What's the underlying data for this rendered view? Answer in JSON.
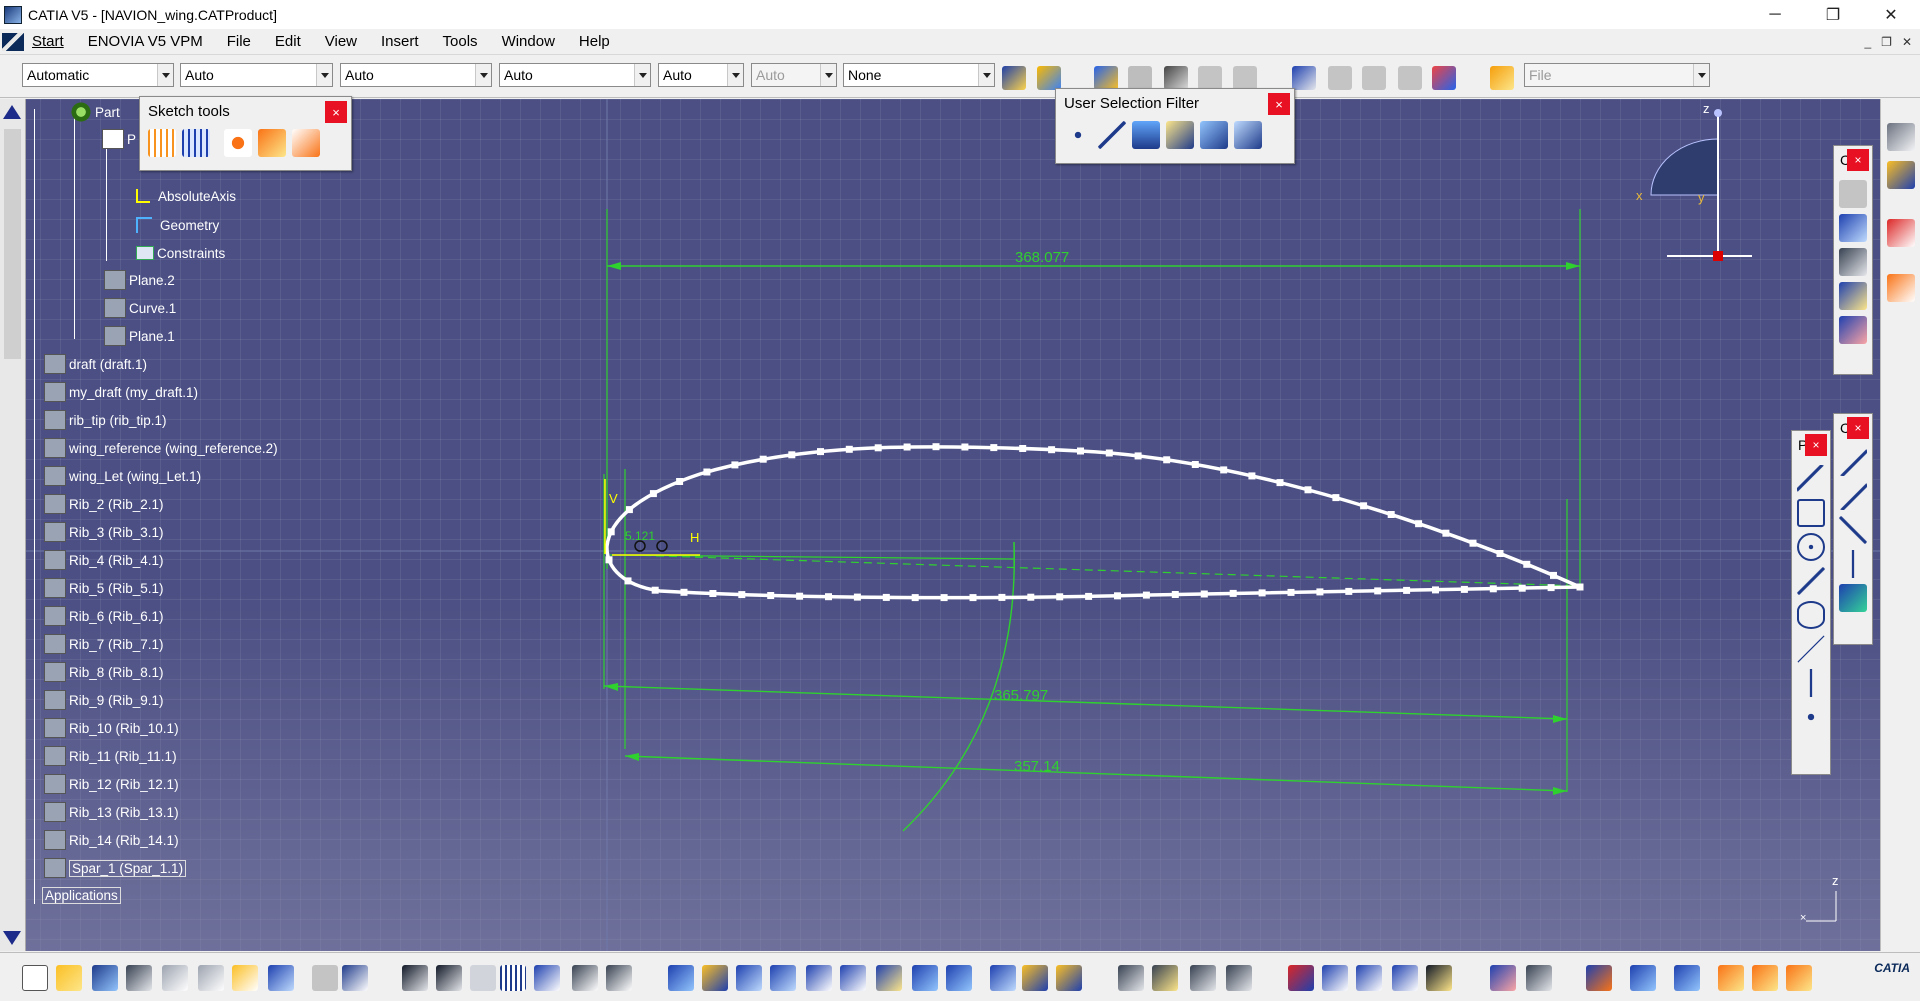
{
  "window": {
    "title": "CATIA V5 - [NAVION_wing.CATProduct]",
    "controls": {
      "minimize": "─",
      "restore": "❐",
      "close": "✕"
    }
  },
  "menu": {
    "items": [
      "Start",
      "ENOVIA V5 VPM",
      "File",
      "Edit",
      "View",
      "Insert",
      "Tools",
      "Window",
      "Help"
    ],
    "mdi_controls": {
      "minimize": "_",
      "restore": "❐",
      "close": "✕"
    }
  },
  "toolbar": {
    "combos": [
      {
        "value": "Automatic",
        "disabled": false
      },
      {
        "value": "Auto",
        "disabled": false
      },
      {
        "value": "Auto",
        "disabled": false
      },
      {
        "value": "Auto",
        "disabled": false
      },
      {
        "value": "Auto",
        "disabled": false
      },
      {
        "value": "Auto",
        "disabled": true
      },
      {
        "value": "None",
        "disabled": false
      },
      {
        "value": "File",
        "disabled": true
      }
    ]
  },
  "sketch_tools": {
    "title": "Sketch tools",
    "close": "×"
  },
  "user_selection_filter": {
    "title": "User Selection Filter",
    "close": "×"
  },
  "side_panels": {
    "panel_c1": {
      "label": "C",
      "close": "×"
    },
    "panel_c2": {
      "label": "C",
      "close": "×"
    },
    "panel_p": {
      "label": "P",
      "close": "×"
    }
  },
  "tree": {
    "nodes": [
      {
        "label": "Part",
        "icon": "gear-icon"
      },
      {
        "label": "P",
        "icon": "part-icon"
      },
      {
        "label": "AbsoluteAxis",
        "icon": "axis-icon"
      },
      {
        "label": "Geometry",
        "icon": "geometry-icon"
      },
      {
        "label": "Constraints",
        "icon": "constraints-icon"
      },
      {
        "label": "Plane.2",
        "icon": "plane-icon"
      },
      {
        "label": "Curve.1",
        "icon": "curve-icon"
      },
      {
        "label": "Plane.1",
        "icon": "plane-icon"
      },
      {
        "label": "draft (draft.1)",
        "icon": "component-icon"
      },
      {
        "label": "my_draft (my_draft.1)",
        "icon": "component-icon"
      },
      {
        "label": "rib_tip (rib_tip.1)",
        "icon": "component-icon"
      },
      {
        "label": "wing_reference (wing_reference.2)",
        "icon": "component-icon"
      },
      {
        "label": "wing_Let (wing_Let.1)",
        "icon": "component-icon"
      },
      {
        "label": "Rib_2 (Rib_2.1)",
        "icon": "component-icon"
      },
      {
        "label": "Rib_3 (Rib_3.1)",
        "icon": "component-icon"
      },
      {
        "label": "Rib_4 (Rib_4.1)",
        "icon": "component-icon"
      },
      {
        "label": "Rib_5 (Rib_5.1)",
        "icon": "component-icon"
      },
      {
        "label": "Rib_6 (Rib_6.1)",
        "icon": "component-icon"
      },
      {
        "label": "Rib_7 (Rib_7.1)",
        "icon": "component-icon"
      },
      {
        "label": "Rib_8 (Rib_8.1)",
        "icon": "component-icon"
      },
      {
        "label": "Rib_9 (Rib_9.1)",
        "icon": "component-icon"
      },
      {
        "label": "Rib_10 (Rib_10.1)",
        "icon": "component-icon"
      },
      {
        "label": "Rib_11 (Rib_11.1)",
        "icon": "component-icon"
      },
      {
        "label": "Rib_12 (Rib_12.1)",
        "icon": "component-icon"
      },
      {
        "label": "Rib_13 (Rib_13.1)",
        "icon": "component-icon"
      },
      {
        "label": "Rib_14 (Rib_14.1)",
        "icon": "component-icon"
      },
      {
        "label": "Spar_1 (Spar_1.1)",
        "icon": "component-icon"
      },
      {
        "label": "Applications",
        "icon": "none"
      }
    ]
  },
  "sketch": {
    "dimensions": [
      "368.077",
      "365.797",
      "357.14"
    ],
    "small_dim": "5.121",
    "axis_h": "H",
    "axis_v": "V",
    "compass": {
      "x": "x",
      "y": "y",
      "z": "z"
    },
    "corner_axis": {
      "z": "z"
    },
    "colors": {
      "profile": "#ffffff",
      "dimension": "#2fd12f",
      "background": "#4b4f83"
    }
  },
  "brand": "CATIA"
}
